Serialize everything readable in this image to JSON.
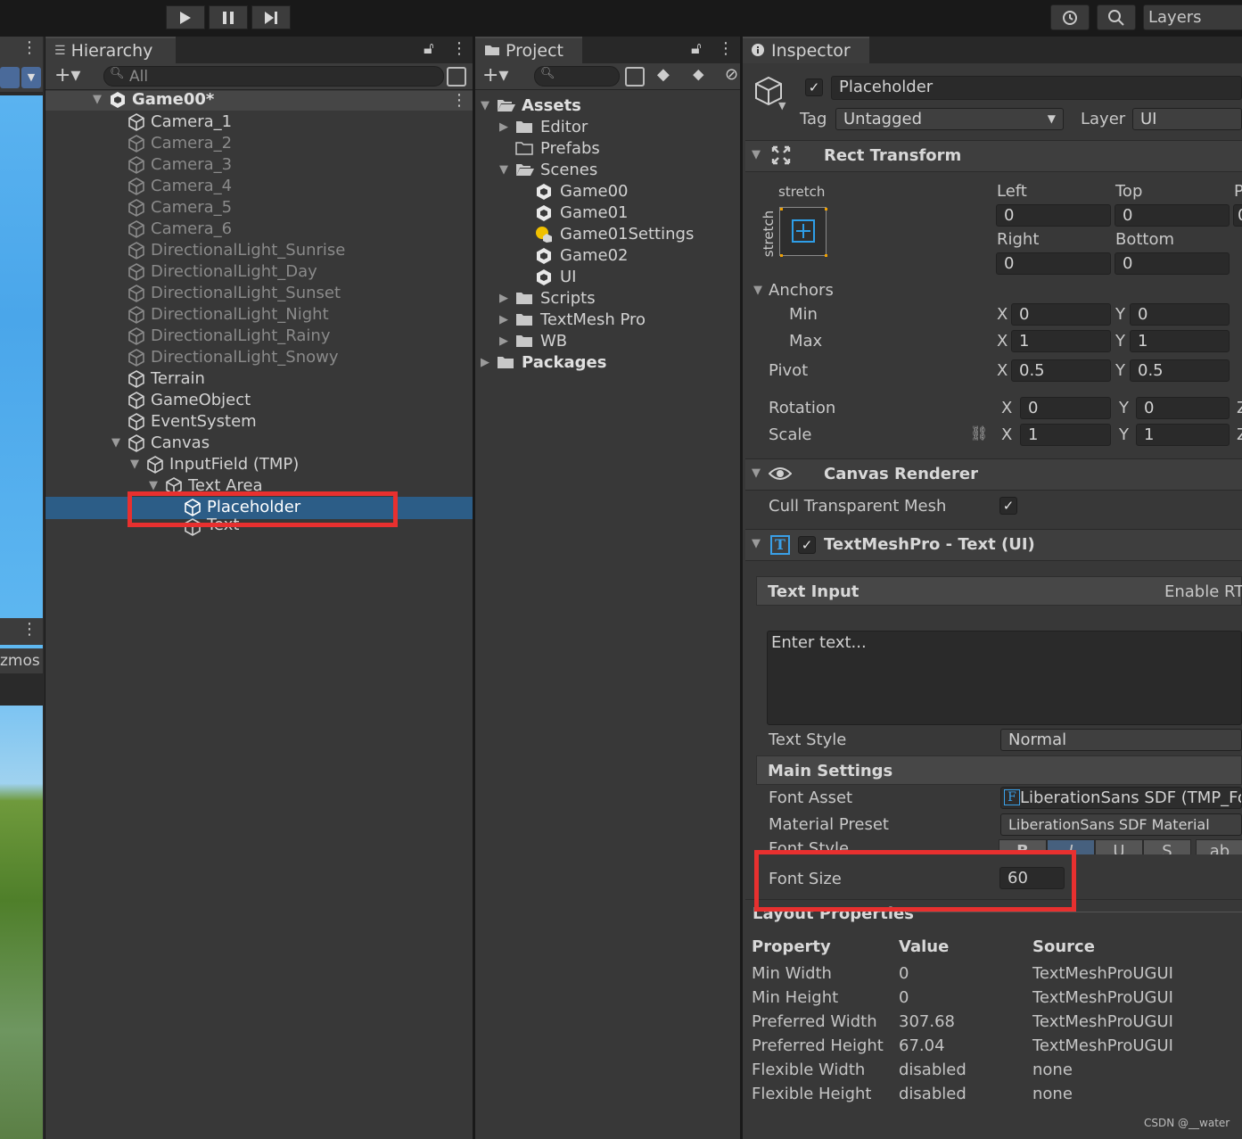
{
  "toolbar": {
    "play_icon": "play-icon",
    "pause_icon": "pause-icon",
    "step_icon": "step-icon",
    "history_icon": "history-icon",
    "search_icon": "search-icon",
    "layers_label": "Layers"
  },
  "scene": {
    "gizmos_label": "zmos"
  },
  "hierarchy": {
    "tab_label": "Hierarchy",
    "search_placeholder": "All",
    "items": [
      {
        "label": "Game00*"
      },
      {
        "label": "Camera_1"
      },
      {
        "label": "Camera_2"
      },
      {
        "label": "Camera_3"
      },
      {
        "label": "Camera_4"
      },
      {
        "label": "Camera_5"
      },
      {
        "label": "Camera_6"
      },
      {
        "label": "DirectionalLight_Sunrise"
      },
      {
        "label": "DirectionalLight_Day"
      },
      {
        "label": "DirectionalLight_Sunset"
      },
      {
        "label": "DirectionalLight_Night"
      },
      {
        "label": "DirectionalLight_Rainy"
      },
      {
        "label": "DirectionalLight_Snowy"
      },
      {
        "label": "Terrain"
      },
      {
        "label": "GameObject"
      },
      {
        "label": "EventSystem"
      },
      {
        "label": "Canvas"
      },
      {
        "label": "InputField (TMP)"
      },
      {
        "label": "Text Area"
      },
      {
        "label": "Placeholder"
      },
      {
        "label": "Text"
      }
    ]
  },
  "project": {
    "tab_label": "Project",
    "items": [
      {
        "label": "Assets"
      },
      {
        "label": "Editor"
      },
      {
        "label": "Prefabs"
      },
      {
        "label": "Scenes"
      },
      {
        "label": "Game00"
      },
      {
        "label": "Game01"
      },
      {
        "label": "Game01Settings"
      },
      {
        "label": "Game02"
      },
      {
        "label": "UI"
      },
      {
        "label": "Scripts"
      },
      {
        "label": "TextMesh Pro"
      },
      {
        "label": "WB"
      },
      {
        "label": "Packages"
      }
    ]
  },
  "inspector": {
    "tab_label": "Inspector",
    "object_name": "Placeholder",
    "tag_label": "Tag",
    "tag_value": "Untagged",
    "layer_label": "Layer",
    "layer_value": "UI",
    "rect_transform": {
      "title": "Rect Transform",
      "anchor_preset_h": "stretch",
      "anchor_preset_v": "stretch",
      "left_label": "Left",
      "left": "0",
      "top_label": "Top",
      "top": "0",
      "pos_z_label": "P",
      "pos_z": "0",
      "right_label": "Right",
      "right": "0",
      "bottom_label": "Bottom",
      "bottom": "0",
      "anchors_label": "Anchors",
      "min_label": "Min",
      "min_x": "0",
      "min_y": "0",
      "max_label": "Max",
      "max_x": "1",
      "max_y": "1",
      "pivot_label": "Pivot",
      "pivot_x": "0.5",
      "pivot_y": "0.5",
      "rotation_label": "Rotation",
      "rot_x": "0",
      "rot_y": "0",
      "scale_label": "Scale",
      "scale_x": "1",
      "scale_y": "1",
      "x": "X",
      "y": "Y",
      "z": "Z"
    },
    "canvas_renderer": {
      "title": "Canvas Renderer",
      "cull_label": "Cull Transparent Mesh"
    },
    "tmp": {
      "title": "TextMeshPro - Text (UI)",
      "text_input_label": "Text Input",
      "enable_rtl": "Enable RT",
      "text_value": "Enter text...",
      "text_style_label": "Text Style",
      "text_style": "Normal",
      "main_settings_label": "Main Settings",
      "font_asset_label": "Font Asset",
      "font_asset": "LiberationSans SDF (TMP_Fo",
      "material_preset_label": "Material Preset",
      "material_preset": "LiberationSans SDF Material",
      "font_style_label": "Font Style",
      "style_b": "B",
      "style_i": "I",
      "style_u": "U",
      "style_s": "S",
      "style_ab": "ab",
      "font_size_label": "Font Size",
      "font_size": "60"
    },
    "layout": {
      "title": "Layout Properties",
      "headers": [
        "Property",
        "Value",
        "Source"
      ],
      "rows": [
        [
          "Min Width",
          "0",
          "TextMeshProUGUI"
        ],
        [
          "Min Height",
          "0",
          "TextMeshProUGUI"
        ],
        [
          "Preferred Width",
          "307.68",
          "TextMeshProUGUI"
        ],
        [
          "Preferred Height",
          "67.04",
          "TextMeshProUGUI"
        ],
        [
          "Flexible Width",
          "disabled",
          "none"
        ],
        [
          "Flexible Height",
          "disabled",
          "none"
        ]
      ]
    }
  },
  "watermark": "CSDN @__water",
  "colors": {
    "highlight": "#e8302f",
    "selection": "#2c5d87",
    "panel": "#383838"
  }
}
